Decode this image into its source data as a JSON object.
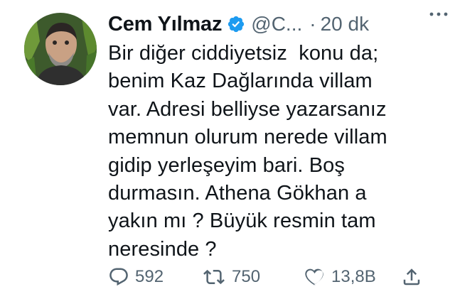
{
  "tweet": {
    "author_name": "Cem Yılmaz",
    "handle": "@C...",
    "separator": "·",
    "time": "20 dk",
    "text_lines": [
      "Bir diğer ciddiyetsiz  konu da;",
      "benim Kaz Dağlarında villam",
      "var. Adresi belliyse yazarsanız",
      "memnun olurum nerede villam",
      "gidip yerleşeyim bari. Boş",
      "durmasın. Athena Gökhan a",
      "yakın mı ? Büyük resmin tam",
      "neresinde ?"
    ],
    "actions": {
      "reply_count": "592",
      "retweet_count": "750",
      "like_count": "13,8B"
    },
    "icons": {
      "verified": "verified-badge-icon",
      "more": "more-options-icon",
      "reply": "reply-icon",
      "retweet": "retweet-icon",
      "like": "like-heart-icon",
      "share": "share-icon"
    },
    "colors": {
      "verified": "#1d9bf0",
      "text": "#0f1419",
      "secondary": "#536471"
    }
  }
}
